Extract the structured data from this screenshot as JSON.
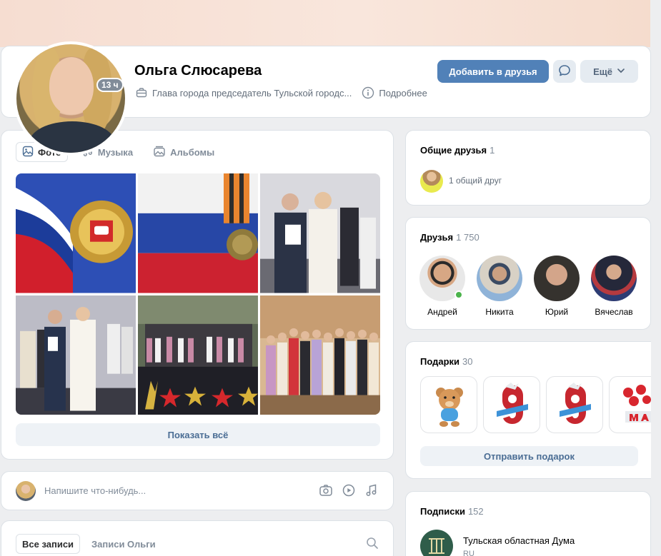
{
  "profile": {
    "name": "Ольга Слюсарева",
    "last_seen": "13 ч",
    "job": "Глава города председатель Тульской городс...",
    "details_label": "Подробнее"
  },
  "actions": {
    "add_friend": "Добавить в друзья",
    "more": "Ещё"
  },
  "media": {
    "tabs": [
      {
        "label": "Фото",
        "icon": "photo-icon",
        "active": true
      },
      {
        "label": "Музыка",
        "icon": "music-note-icon",
        "active": false
      },
      {
        "label": "Альбомы",
        "icon": "albums-icon",
        "active": false
      }
    ],
    "show_all": "Показать всё"
  },
  "compose": {
    "placeholder": "Напишите что-нибудь..."
  },
  "wall": {
    "tab_all": "Все записи",
    "tab_own": "Записи Ольги"
  },
  "common_friends": {
    "title": "Общие друзья",
    "count": "1",
    "text": "1 общий друг"
  },
  "friends": {
    "title": "Друзья",
    "count": "1 750",
    "list": [
      {
        "name": "Андрей",
        "online": true
      },
      {
        "name": "Никита",
        "online": false
      },
      {
        "name": "Юрий",
        "online": false
      },
      {
        "name": "Вячеслав",
        "online": false
      }
    ]
  },
  "gifts": {
    "title": "Подарки",
    "count": "30",
    "send_label": "Отправить подарок"
  },
  "subscriptions": {
    "title": "Подписки",
    "count": "152",
    "items": [
      {
        "name": "Тульская областная Дума",
        "subtitle": "RU"
      }
    ]
  },
  "colors": {
    "accent": "#5181b8",
    "link": "#4a6d94",
    "secondary_button": "#e5ebf1",
    "online": "#4bb34b",
    "page_bg": "#edeef0"
  }
}
